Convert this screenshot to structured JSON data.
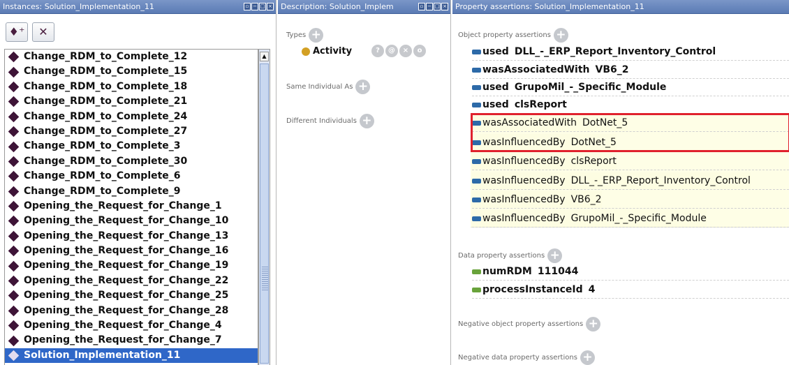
{
  "instances_panel": {
    "title": "Instances: Solution_Implementation_11",
    "items": [
      "Change_RDM_to_Complete_12",
      "Change_RDM_to_Complete_15",
      "Change_RDM_to_Complete_18",
      "Change_RDM_to_Complete_21",
      "Change_RDM_to_Complete_24",
      "Change_RDM_to_Complete_27",
      "Change_RDM_to_Complete_3",
      "Change_RDM_to_Complete_30",
      "Change_RDM_to_Complete_6",
      "Change_RDM_to_Complete_9",
      "Opening_the_Request_for_Change_1",
      "Opening_the_Request_for_Change_10",
      "Opening_the_Request_for_Change_13",
      "Opening_the_Request_for_Change_16",
      "Opening_the_Request_for_Change_19",
      "Opening_the_Request_for_Change_22",
      "Opening_the_Request_for_Change_25",
      "Opening_the_Request_for_Change_28",
      "Opening_the_Request_for_Change_4",
      "Opening_the_Request_for_Change_7",
      "Solution_Implementation_11"
    ],
    "selected": "Solution_Implementation_11"
  },
  "description_panel": {
    "title": "Description: Solution_Implem",
    "types_label": "Types",
    "type_value": "Activity",
    "same_individual_label": "Same Individual As",
    "different_individuals_label": "Different Individuals"
  },
  "property_panel": {
    "title": "Property assertions: Solution_Implementation_11",
    "object_label": "Object property assertions",
    "object_assertions": [
      {
        "prop": "used",
        "value": "DLL_-_ERP_Report_Inventory_Control"
      },
      {
        "prop": "wasAssociatedWith",
        "value": "VB6_2"
      },
      {
        "prop": "used",
        "value": "GrupoMil_-_Specific_Module"
      },
      {
        "prop": "used",
        "value": "clsReport"
      },
      {
        "prop": "wasAssociatedWith",
        "value": "DotNet_5"
      },
      {
        "prop": "wasInfluencedBy",
        "value": "DotNet_5"
      },
      {
        "prop": "wasInfluencedBy",
        "value": "clsReport"
      },
      {
        "prop": "wasInfluencedBy",
        "value": "DLL_-_ERP_Report_Inventory_Control"
      },
      {
        "prop": "wasInfluencedBy",
        "value": "VB6_2"
      },
      {
        "prop": "wasInfluencedBy",
        "value": "GrupoMil_-_Specific_Module"
      }
    ],
    "data_label": "Data property assertions",
    "data_assertions": [
      {
        "prop": "numRDM",
        "value": "111044"
      },
      {
        "prop": "processInstanceId",
        "value": "4"
      }
    ],
    "negative_object_label": "Negative object property assertions",
    "negative_data_label": "Negative data property assertions"
  },
  "colors": {
    "titlebar": "#5b7bb4",
    "selected_row": "#2f67c8",
    "object_prop_icon": "#2d6aa8",
    "data_prop_icon": "#69a33b",
    "type_dot": "#d3a024",
    "highlight_box": "#e0212d"
  },
  "icons": {
    "add_individual": "diamond-add-icon",
    "delete_individual": "diamond-delete-icon"
  }
}
